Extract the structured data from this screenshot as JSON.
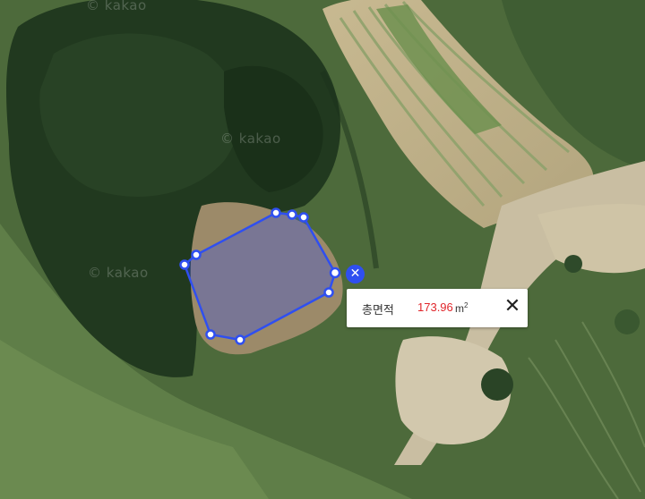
{
  "map": {
    "watermark_text": "© kakao",
    "measurement": {
      "area_label": "총면적",
      "area_value": "173.96",
      "area_unit_base": "m",
      "area_unit_exp": "2",
      "polygon_fill": "#2f4ff0",
      "polygon_stroke": "#2f4ff0",
      "value_color": "#e0262b"
    },
    "controls": {
      "remove_shape_icon": "close-icon",
      "tooltip_close_icon": "close-icon",
      "remove_shape_glyph": "✕",
      "tooltip_close_glyph": "✕"
    }
  }
}
